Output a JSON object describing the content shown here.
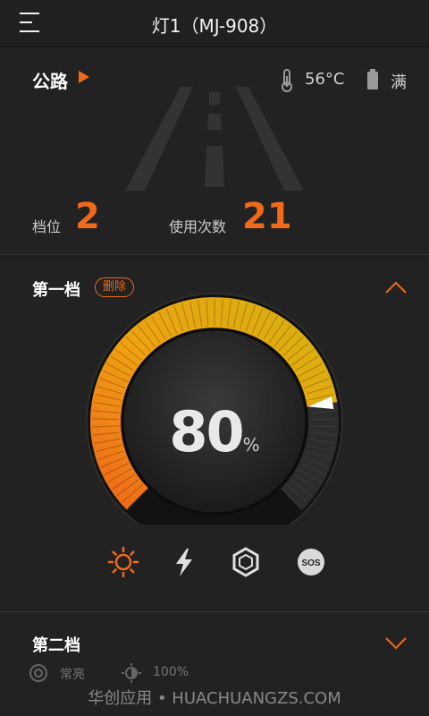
{
  "header": {
    "title": "灯1（MJ-908）",
    "menu_icon": "menu-icon"
  },
  "status": {
    "mode": "公路",
    "temperature": "56°C",
    "battery": "满",
    "gear_label": "档位",
    "gear_value": "2",
    "uses_label": "使用次数",
    "uses_value": "21"
  },
  "level1": {
    "title": "第一档",
    "delete_label": "删除",
    "brightness_value": "80",
    "brightness_unit": "%",
    "brightness_level": 0.8,
    "modes": [
      "steady-light-icon",
      "flash-icon",
      "strobe-icon",
      "sos-icon"
    ],
    "selected_mode": "steady-light-icon",
    "sos_text": "SOS"
  },
  "level2": {
    "title": "第二档",
    "mode_text": "常亮",
    "brightness_text": "100%"
  },
  "watermark": "华创应用 • HUACHUANGZS.COM",
  "colors": {
    "accent": "#ef6a1a",
    "background": "#1f1f1f",
    "dial_yellow": "#d8b20f"
  }
}
